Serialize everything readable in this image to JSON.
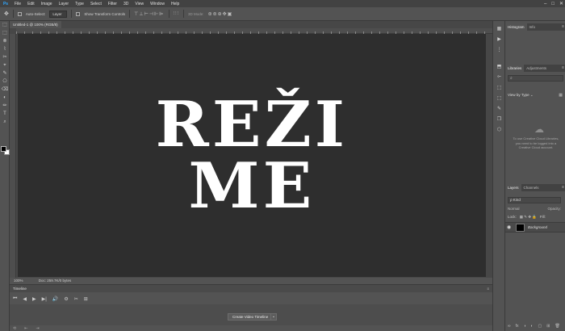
{
  "app": {
    "logo": "Ps"
  },
  "menubar": {
    "items": [
      "File",
      "Edit",
      "Image",
      "Layer",
      "Type",
      "Select",
      "Filter",
      "3D",
      "View",
      "Window",
      "Help"
    ]
  },
  "window_controls": {
    "minimize": "–",
    "maximize": "□",
    "close": "✕"
  },
  "optionsbar": {
    "move_icon": "✥",
    "auto_select_label": "Auto-Select:",
    "auto_select_target": "Layer",
    "show_transform_label": "Show Transform Controls",
    "align_glyphs": "⊤⊥⊢⊣⊩⊫",
    "distribute_glyphs": "⫶⫶⫶",
    "mode_3d_label": "3D Mode:",
    "mode_3d_glyphs": "⊛⊚⊕✥▣"
  },
  "toolbar": {
    "icons": [
      "⬚",
      "⬚",
      "⊗",
      "⌇",
      "✂",
      "⌖",
      "✎",
      "⎔",
      "⌫",
      "◐",
      "✏",
      "T",
      "⌕"
    ]
  },
  "document": {
    "tab_title": "Untitled-1 @ 100% (RGB/8)",
    "headline_line1": "REŽI",
    "headline_line2": "ME",
    "zoom": "100%",
    "doc_size": "Doc: 259.7K/0 bytes"
  },
  "timeline": {
    "title": "Timeline",
    "controls": [
      "⏮",
      "◀",
      "▶",
      "▶|",
      "🔊",
      "⚙",
      "✂",
      "⊞"
    ],
    "create_button_label": "Create Video Timeline",
    "create_button_arrow": "⌄",
    "footer_icons": [
      "⟲",
      "⇤",
      "⇥"
    ],
    "menu": "≡"
  },
  "icon_strip": {
    "icons": [
      "▦",
      "▶",
      "⋮",
      "⬒",
      "⟜",
      "⬚",
      "⬚",
      "✎",
      "❐",
      "⬡"
    ]
  },
  "panels": {
    "histogram_tabs": [
      "Histogram",
      "Info"
    ],
    "libraries_tabs": [
      "Libraries",
      "Adjustments"
    ],
    "library_search_icon": "⌕",
    "library_view_label": "View by Type",
    "library_view_caret": "⌄",
    "library_grid_icon": "▦",
    "cc_icon": "☁",
    "library_message": "To use Creative Cloud Libraries, you need to be logged into a Creative Cloud account.",
    "layers_tabs": [
      "Layers",
      "Channels"
    ],
    "layers_filter_label": "ρ Kind",
    "layers_blend_mode": "Normal",
    "layers_opacity_label": "Opacity:",
    "layers_lock_label": "Lock:",
    "layers_lock_glyphs": "▦ ✎ ✥ 🔒",
    "layers_fill_label": "Fill:",
    "layer_eye": "◉",
    "layer_name": "Background",
    "layers_footer_icons": [
      "∞",
      "fx",
      "◑",
      "◐",
      "▢",
      "⊞",
      "🗑"
    ],
    "panel_menu": "≡"
  },
  "colors": {
    "foreground": "#000000",
    "background": "#ffffff",
    "canvas": "#2e2e2e",
    "text": "#ffffff",
    "accent": "#31a8ff"
  }
}
